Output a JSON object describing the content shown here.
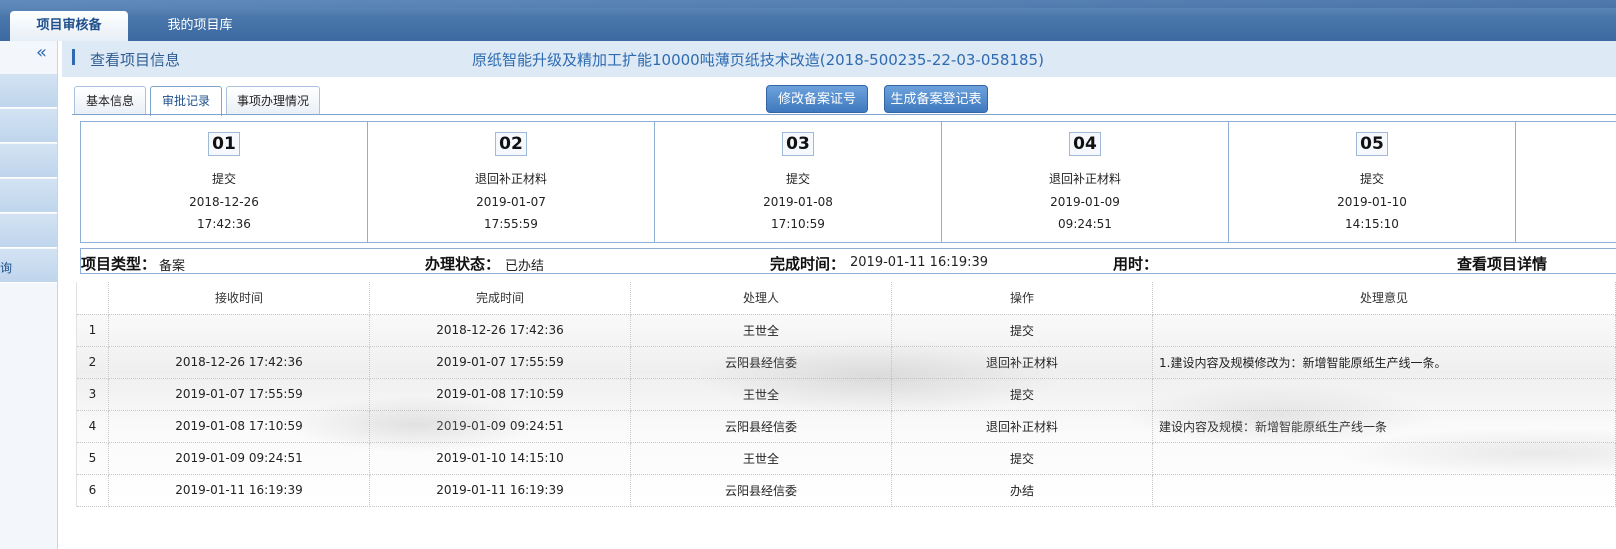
{
  "top_tabs": [
    {
      "label": "项目审核备"
    },
    {
      "label": "我的项目库"
    }
  ],
  "sidebar": {
    "collapse_glyph": "«",
    "items": [
      {
        "label": ""
      },
      {
        "label": ""
      },
      {
        "label": ""
      },
      {
        "label": ""
      },
      {
        "label": ""
      },
      {
        "label": "询"
      }
    ]
  },
  "header": {
    "title": "查看项目信息",
    "project_name": "原纸智能升级及精加工扩能10000吨薄页纸技术改造(2018-500235-22-03-058185)"
  },
  "inner_tabs": [
    {
      "label": "基本信息"
    },
    {
      "label": "审批记录"
    },
    {
      "label": "事项办理情况"
    }
  ],
  "selected_tab": "审批记录",
  "buttons": {
    "modify": "修改备案证号",
    "generate": "生成备案登记表"
  },
  "steps": [
    {
      "num": "01",
      "action": "提交",
      "date": "2018-12-26",
      "time": "17:42:36"
    },
    {
      "num": "02",
      "action": "退回补正材料",
      "date": "2019-01-07",
      "time": "17:55:59"
    },
    {
      "num": "03",
      "action": "提交",
      "date": "2019-01-08",
      "time": "17:10:59"
    },
    {
      "num": "04",
      "action": "退回补正材料",
      "date": "2019-01-09",
      "time": "09:24:51"
    },
    {
      "num": "05",
      "action": "提交",
      "date": "2019-01-10",
      "time": "14:15:10"
    }
  ],
  "summary": {
    "type_label": "项目类型：",
    "type_value": "备案",
    "status_label": "办理状态：",
    "status_value": "已办结",
    "finish_label": "完成时间：",
    "finish_value": "2019-01-11 16:19:39",
    "used_label": "用时：",
    "detail_link": "查看项目详情"
  },
  "records": {
    "columns": [
      "",
      "接收时间",
      "完成时间",
      "处理人",
      "操作",
      "处理意见"
    ],
    "rows": [
      [
        "1",
        "",
        "2018-12-26 17:42:36",
        "王世全",
        "提交",
        ""
      ],
      [
        "2",
        "2018-12-26 17:42:36",
        "2019-01-07 17:55:59",
        "云阳县经信委",
        "退回补正材料",
        "1.建设内容及规模修改为：新增智能原纸生产线一条。"
      ],
      [
        "3",
        "2019-01-07 17:55:59",
        "2019-01-08 17:10:59",
        "王世全",
        "提交",
        ""
      ],
      [
        "4",
        "2019-01-08 17:10:59",
        "2019-01-09 09:24:51",
        "云阳县经信委",
        "退回补正材料",
        "建设内容及规模：新增智能原纸生产线一条"
      ],
      [
        "5",
        "2019-01-09 09:24:51",
        "2019-01-10 14:15:10",
        "王世全",
        "提交",
        ""
      ],
      [
        "6",
        "2019-01-11 16:19:39",
        "2019-01-11 16:19:39",
        "云阳县经信委",
        "办结",
        ""
      ]
    ]
  },
  "colors": {
    "topbar": "#4a77ab",
    "accent": "#2e6bb0",
    "header_bg": "#dde9f5"
  }
}
